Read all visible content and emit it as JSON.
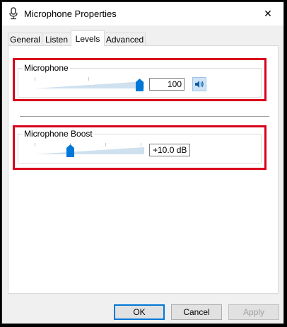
{
  "window": {
    "title": "Microphone Properties",
    "close_glyph": "✕"
  },
  "tabs": [
    {
      "label": "General"
    },
    {
      "label": "Listen"
    },
    {
      "label": "Levels"
    },
    {
      "label": "Advanced"
    }
  ],
  "levels": {
    "microphone": {
      "label": "Microphone",
      "value": "100",
      "level_fraction": 1.0
    },
    "boost": {
      "label": "Microphone Boost",
      "value": "+10.0 dB",
      "level_fraction": 0.333
    }
  },
  "buttons": {
    "ok": "OK",
    "cancel": "Cancel",
    "apply": "Apply"
  },
  "colors": {
    "accent": "#0078d7",
    "highlight": "#d9001b"
  }
}
